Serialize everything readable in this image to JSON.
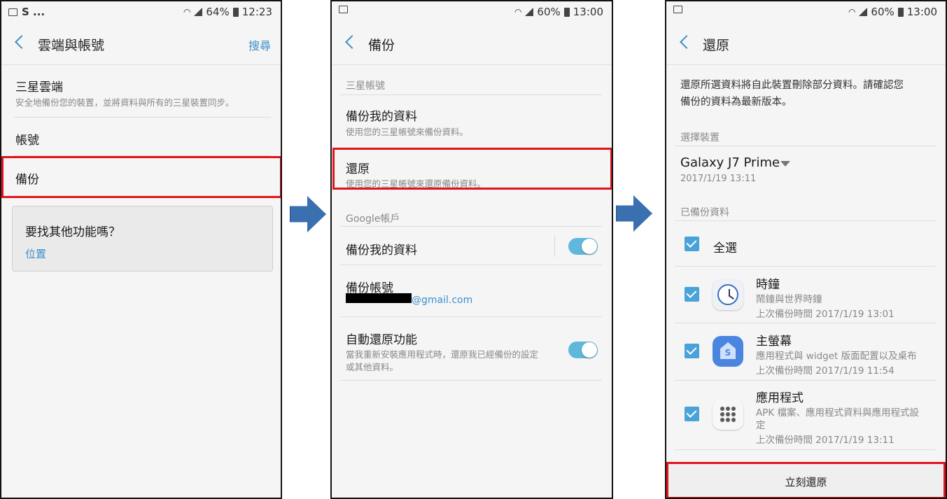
{
  "colors": {
    "accent": "#3d8ec9",
    "highlight": "#e0141c",
    "toggle_on": "#5fb8dc",
    "checkbox": "#4aa3d8",
    "arrow": "#3a6fb0"
  },
  "screen1": {
    "status": {
      "left": "S ...",
      "battery": "64%",
      "time": "12:23"
    },
    "title": "雲端與帳號",
    "search": "搜尋",
    "items": [
      {
        "title": "三星雲端",
        "subtitle": "安全地備份您的裝置，並將資料與所有的三星裝置同步。"
      },
      {
        "title": "帳號"
      },
      {
        "title": "備份"
      }
    ],
    "card": {
      "title": "要找其他功能嗎？",
      "link": "位置"
    }
  },
  "screen2": {
    "status": {
      "battery": "60%",
      "time": "13:00"
    },
    "title": "備份",
    "section_samsung": "三星帳號",
    "backup_item": {
      "title": "備份我的資料",
      "subtitle": "使用您的三星帳號來備份資料。"
    },
    "restore_item": {
      "title": "還原",
      "subtitle": "使用您的三星帳號來還原備份資料。"
    },
    "section_google": "Google帳戶",
    "google_backup": {
      "title": "備份我的資料",
      "toggle": true
    },
    "backup_account": {
      "title": "備份帳號",
      "email": "@gmail.com"
    },
    "auto_restore": {
      "title": "自動還原功能",
      "subtitle_line1": "當我重新安裝應用程式時，還原我已經備份的設定",
      "subtitle_line2": "或其他資料。",
      "toggle": true
    }
  },
  "screen3": {
    "status": {
      "battery": "60%",
      "time": "13:00"
    },
    "title": "還原",
    "description_line1": "還原所選資料將自此裝置刪除部分資料。請確認您",
    "description_line2": "備份的資料為最新版本。",
    "section_device": "選擇裝置",
    "device": {
      "name": "Galaxy J7 Prime",
      "date": "2017/1/19 13:11"
    },
    "section_backed": "已備份資料",
    "select_all": "全選",
    "items": [
      {
        "icon": "clock-icon",
        "title": "時鐘",
        "subtitle": "鬧鐘與世界時鐘",
        "last": "上次備份時間 2017/1/19 13:01"
      },
      {
        "icon": "home-screen-icon",
        "title": "主螢幕",
        "subtitle": "應用程式與 widget 版面配置以及桌布",
        "last": "上次備份時間 2017/1/19 11:54"
      },
      {
        "icon": "apps-icon",
        "title": "應用程式",
        "subtitle_line1": "APK 檔案、應用程式資料與應用程式設",
        "subtitle_line2": "定",
        "last": "上次備份時間 2017/1/19 13:11"
      }
    ],
    "restore_button": "立刻還原"
  }
}
